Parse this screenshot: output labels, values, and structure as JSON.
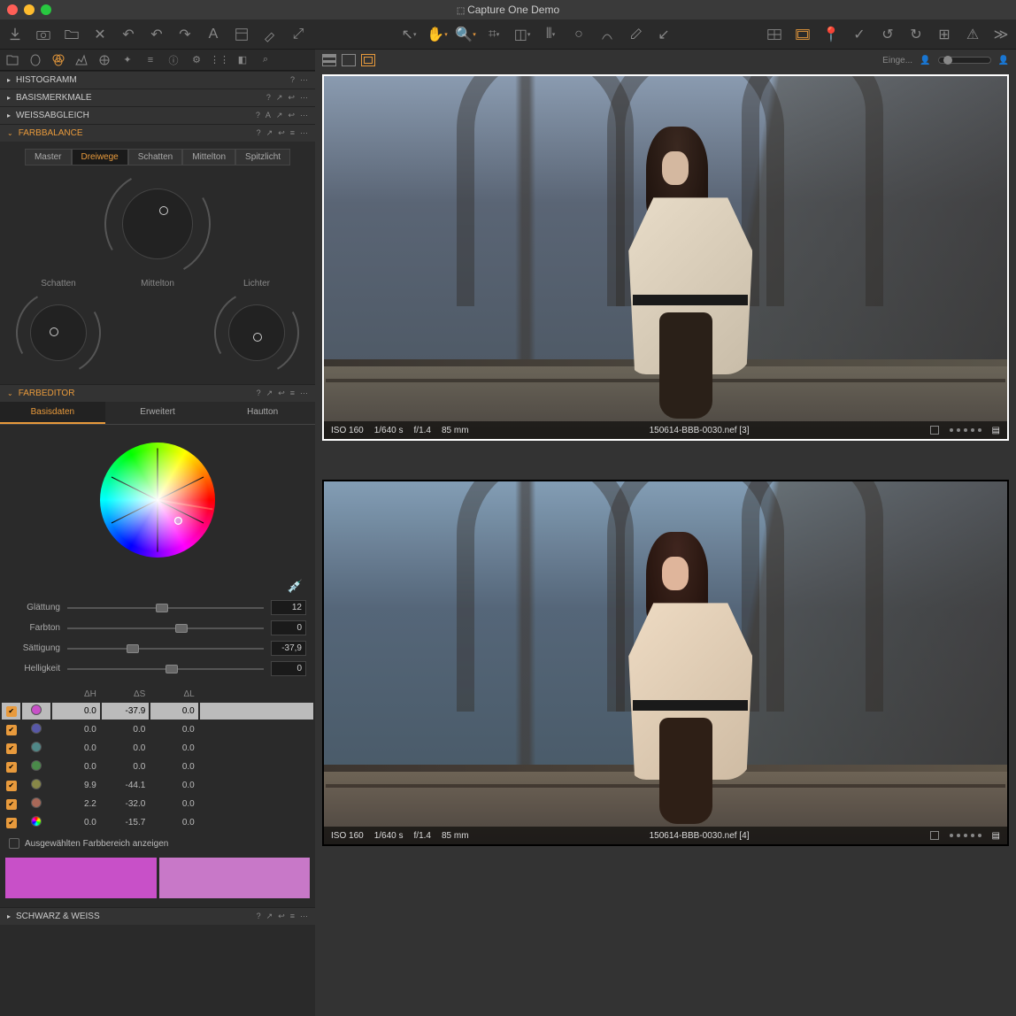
{
  "window": {
    "title": "Capture One Demo"
  },
  "panels": {
    "histogram": "HISTOGRAMM",
    "basis": "BASISMERKMALE",
    "weiss": "WEISSABGLEICH",
    "farbbalance": "FARBBALANCE",
    "farbeditor": "FARBEDITOR",
    "schwarzweiss": "SCHWARZ & WEISS"
  },
  "colorbalance": {
    "tabs": {
      "master": "Master",
      "dreiwege": "Dreiwege",
      "schatten": "Schatten",
      "mittelton": "Mittelton",
      "spitzlicht": "Spitzlicht"
    },
    "labels": {
      "schatten": "Schatten",
      "mittelton": "Mittelton",
      "lichter": "Lichter"
    }
  },
  "editor": {
    "tabs": {
      "basis": "Basisdaten",
      "erweitert": "Erweitert",
      "hautton": "Hautton"
    },
    "sliders": {
      "glattung": {
        "label": "Glättung",
        "value": "12",
        "pos": 45
      },
      "farbton": {
        "label": "Farbton",
        "value": "0",
        "pos": 55
      },
      "sattigung": {
        "label": "Sättigung",
        "value": "-37,9",
        "pos": 30
      },
      "helligkeit": {
        "label": "Helligkeit",
        "value": "0",
        "pos": 50
      }
    },
    "headers": {
      "dh": "ΔH",
      "ds": "ΔS",
      "dl": "ΔL"
    },
    "rows": [
      {
        "color": "#c850c8",
        "dh": "0.0",
        "ds": "-37.9",
        "dl": "0.0",
        "sel": true
      },
      {
        "color": "#5858a8",
        "dh": "0.0",
        "ds": "0.0",
        "dl": "0.0"
      },
      {
        "color": "#508888",
        "dh": "0.0",
        "ds": "0.0",
        "dl": "0.0"
      },
      {
        "color": "#4a8a4a",
        "dh": "0.0",
        "ds": "0.0",
        "dl": "0.0"
      },
      {
        "color": "#888848",
        "dh": "9.9",
        "ds": "-44.1",
        "dl": "0.0"
      },
      {
        "color": "#a86858",
        "dh": "2.2",
        "ds": "-32.0",
        "dl": "0.0"
      },
      {
        "color": "rainbow",
        "dh": "0.0",
        "ds": "-15.7",
        "dl": "0.0"
      }
    ],
    "showrange": "Ausgewählten Farbbereich anzeigen",
    "previewColors": [
      "#c850c8",
      "#c878c8"
    ]
  },
  "viewer": {
    "einge": "Einge...",
    "images": [
      {
        "iso": "ISO 160",
        "shutter": "1/640 s",
        "aperture": "f/1.4",
        "focal": "85 mm",
        "filename": "150614-BBB-0030.nef [3]"
      },
      {
        "iso": "ISO 160",
        "shutter": "1/640 s",
        "aperture": "f/1.4",
        "focal": "85 mm",
        "filename": "150614-BBB-0030.nef [4]"
      }
    ]
  }
}
